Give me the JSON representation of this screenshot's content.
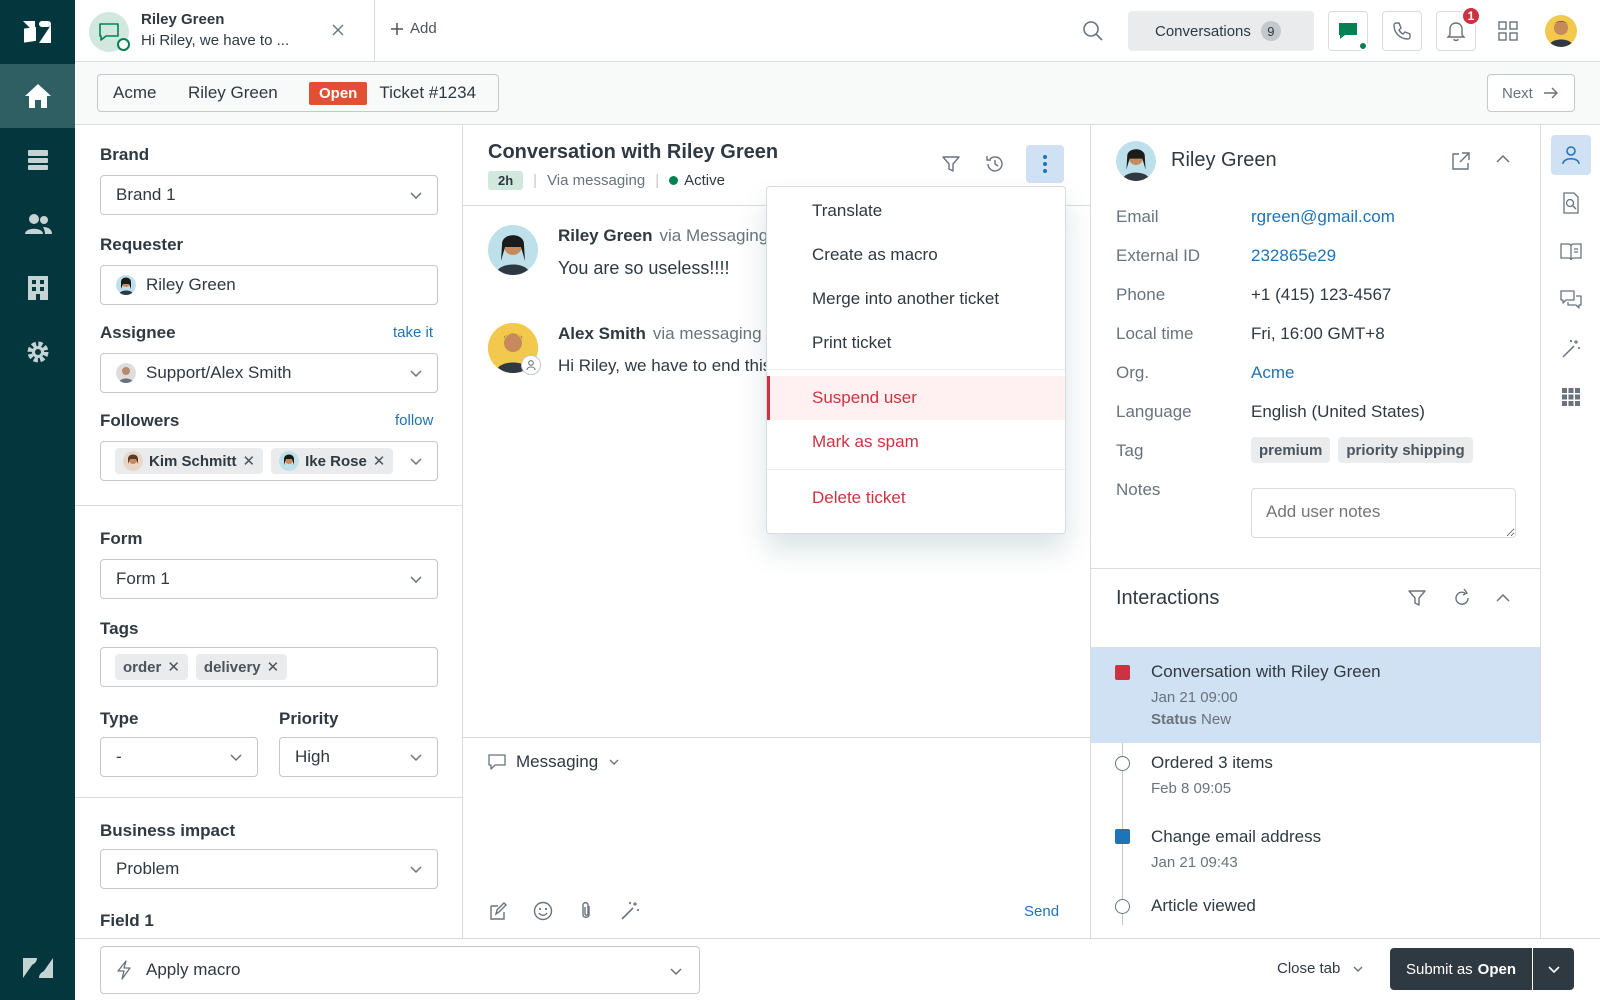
{
  "topbar": {
    "tab_name": "Riley Green",
    "tab_preview": "Hi Riley, we have to ...",
    "add_label": "Add",
    "conversations_label": "Conversations",
    "conversations_count": "9",
    "notifications_count": "1"
  },
  "breadcrumb": {
    "org": "Acme",
    "requester": "Riley Green",
    "status": "Open",
    "ticket": "Ticket #1234",
    "next_label": "Next"
  },
  "props": {
    "brand_label": "Brand",
    "brand_value": "Brand 1",
    "requester_label": "Requester",
    "requester_value": "Riley Green",
    "assignee_label": "Assignee",
    "assignee_link": "take it",
    "assignee_value": "Support/Alex Smith",
    "followers_label": "Followers",
    "followers_link": "follow",
    "followers": [
      "Kim Schmitt",
      "Ike Rose"
    ],
    "form_label": "Form",
    "form_value": "Form 1",
    "tags_label": "Tags",
    "tags": [
      "order",
      "delivery"
    ],
    "type_label": "Type",
    "type_value": "-",
    "priority_label": "Priority",
    "priority_value": "High",
    "impact_label": "Business impact",
    "impact_value": "Problem",
    "field1_label": "Field 1"
  },
  "conversation": {
    "title": "Conversation with Riley Green",
    "age_badge": "2h",
    "via": "Via messaging",
    "status": "Active",
    "messages": [
      {
        "author": "Riley Green",
        "via": "via Messaging",
        "text": "You are so useless!!!!"
      },
      {
        "author": "Alex Smith",
        "via": "via messaging",
        "text": "Hi Riley, we have to end this conversation"
      }
    ],
    "composer_channel": "Messaging",
    "send_label": "Send"
  },
  "menu": {
    "items": [
      "Translate",
      "Create as macro",
      "Merge into another ticket",
      "Print ticket"
    ],
    "danger_items": [
      "Suspend user",
      "Mark as spam"
    ],
    "delete_item": "Delete ticket"
  },
  "context": {
    "name": "Riley Green",
    "email_label": "Email",
    "email": "rgreen@gmail.com",
    "external_id_label": "External ID",
    "external_id": "232865e29",
    "phone_label": "Phone",
    "phone": "+1 (415) 123-4567",
    "local_time_label": "Local time",
    "local_time": "Fri, 16:00 GMT+8",
    "org_label": "Org.",
    "org": "Acme",
    "language_label": "Language",
    "language": "English (United States)",
    "tag_label": "Tag",
    "tags": [
      "premium",
      "priority shipping"
    ],
    "notes_label": "Notes",
    "notes_placeholder": "Add user notes",
    "interactions_title": "Interactions",
    "timeline": [
      {
        "title": "Conversation with Riley Green",
        "date": "Jan 21 09:00",
        "status_label": "Status",
        "status_value": "New"
      },
      {
        "title": "Ordered 3 items",
        "date": "Feb 8 09:05"
      },
      {
        "title": "Change email address",
        "date": "Jan 21 09:43"
      },
      {
        "title": "Article viewed"
      }
    ]
  },
  "footer": {
    "macro_label": "Apply macro",
    "close_tab_label": "Close tab",
    "submit_prefix": "Submit as",
    "submit_status": "Open"
  },
  "colors": {
    "nav_bg": "#03363d",
    "accent_blue": "#1f73b7",
    "status_open": "#e34f32",
    "danger": "#cc3340",
    "messaging_green": "#038153",
    "selected_row": "#cfe1f3"
  }
}
